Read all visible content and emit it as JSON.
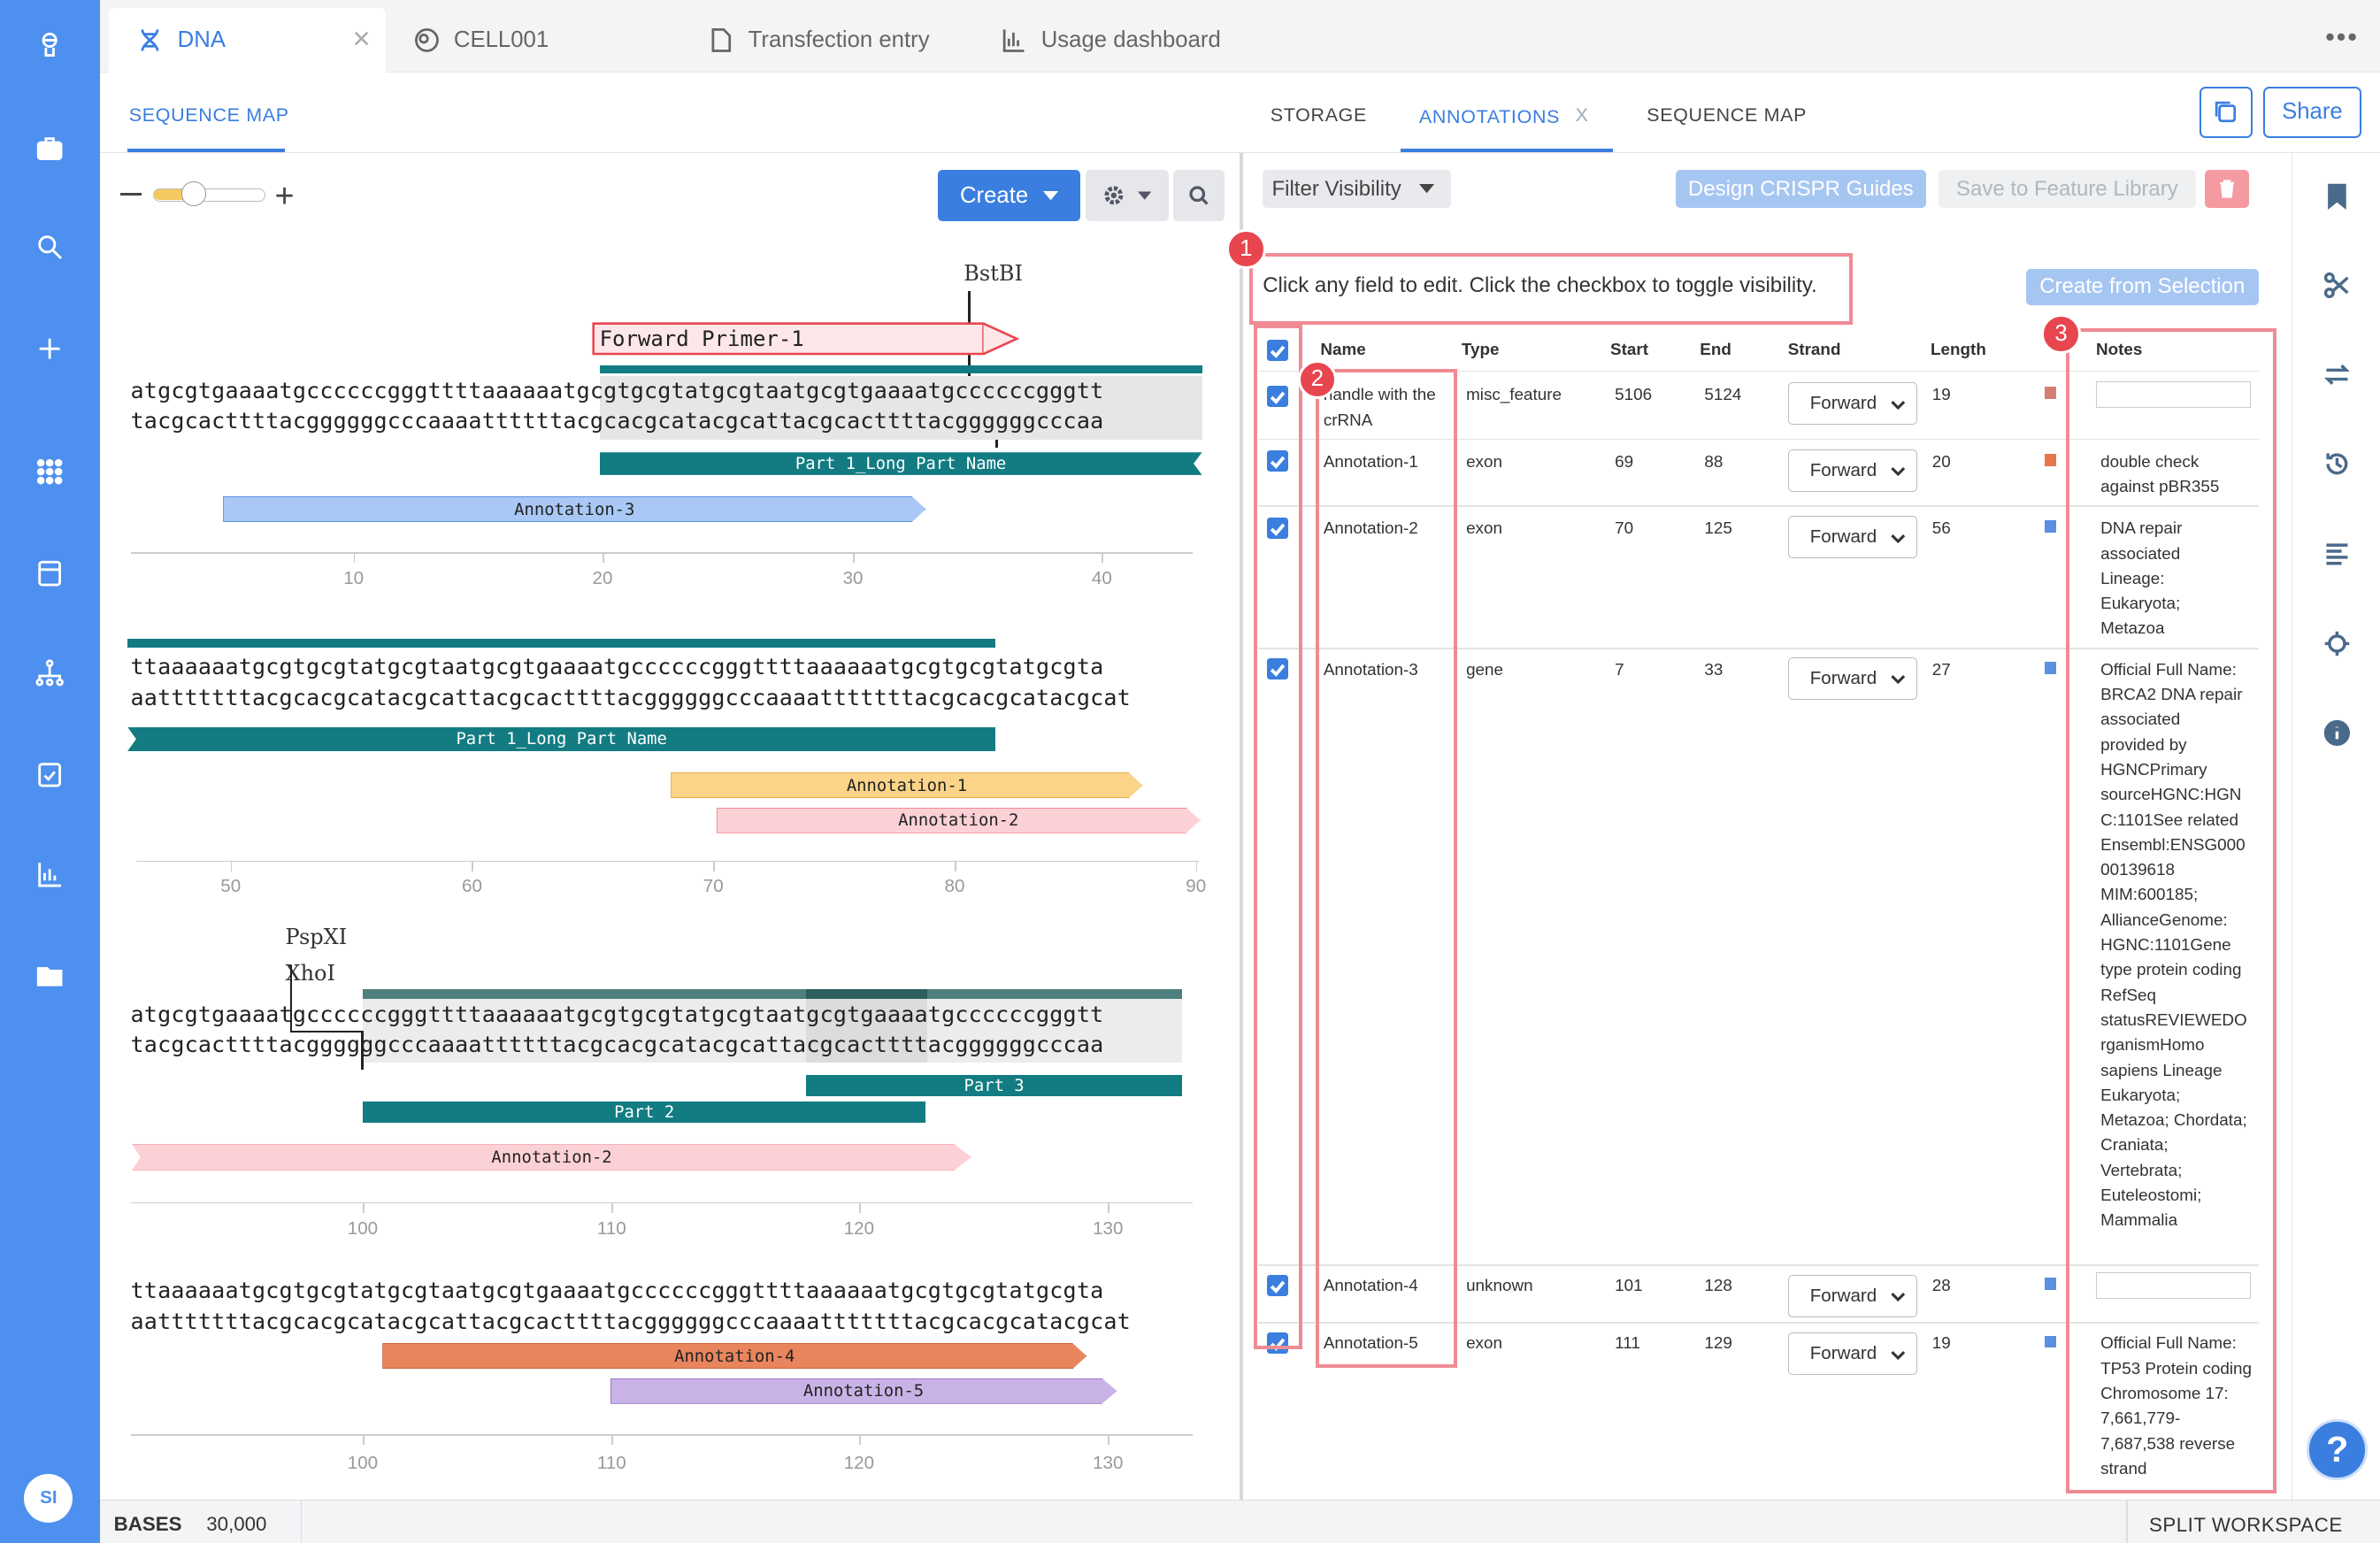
{
  "doc_tabs": [
    {
      "label": "DNA",
      "icon": "dna-icon",
      "active": true
    },
    {
      "label": "CELL001",
      "icon": "cell-icon"
    },
    {
      "label": "Transfection entry",
      "icon": "document-icon"
    },
    {
      "label": "Usage dashboard",
      "icon": "bar-chart-icon"
    }
  ],
  "doc_tab_close": "×",
  "more_menu": "•••",
  "left_subtab": "SEQUENCE MAP",
  "right_subtabs": [
    {
      "label": "STORAGE"
    },
    {
      "label": "ANNOTATIONS",
      "active": true,
      "close": "X"
    },
    {
      "label": "SEQUENCE MAP"
    }
  ],
  "share_label": "Share",
  "create_label": "Create",
  "filter_label": "Filter Visibility",
  "design_crispr_label": "Design CRISPR Guides",
  "save_feature_label": "Save to Feature Library",
  "create_selection_label": "Create from Selection",
  "help_text": "Click any field to edit. Click the checkbox to toggle visibility.",
  "table": {
    "headers": [
      "Name",
      "Type",
      "Start",
      "End",
      "Strand",
      "Length",
      "Notes"
    ],
    "rows": [
      {
        "name": "handle with the crRNA",
        "type": "misc_feature",
        "start": "5106",
        "end": "5124",
        "strand": "Forward",
        "length": "19",
        "color": "#d57f73",
        "notes": ""
      },
      {
        "name": "Annotation-1",
        "type": "exon",
        "start": "69",
        "end": "88",
        "strand": "Forward",
        "length": "20",
        "color": "#e9754a",
        "notes": "double check against pBR355"
      },
      {
        "name": "Annotation-2",
        "type": "exon",
        "start": "70",
        "end": "125",
        "strand": "Forward",
        "length": "56",
        "color": "#5b8fe0",
        "notes": "DNA repair associated Lineage: Eukaryota; Metazoa"
      },
      {
        "name": "Annotation-3",
        "type": "gene",
        "start": "7",
        "end": "33",
        "strand": "Forward",
        "length": "27",
        "color": "#5b8fe0",
        "notes": "Official Full Name: BRCA2 DNA repair associated provided by HGNCPrimary sourceHGNC:HGNC:1101See related Ensembl:ENSG00000139618 MIM:600185; AllianceGenome: HGNC:1101Gene type protein coding RefSeq statusREVIEWEDO rganismHomo sapiens Lineage Eukaryota; Metazoa; Chordata; Craniata; Vertebrata; Euteleostomi; Mammalia"
      },
      {
        "name": "Annotation-4",
        "type": "unknown",
        "start": "101",
        "end": "128",
        "strand": "Forward",
        "length": "28",
        "color": "#5b8fe0",
        "notes": ""
      },
      {
        "name": "Annotation-5",
        "type": "exon",
        "start": "111",
        "end": "129",
        "strand": "Forward",
        "length": "19",
        "color": "#5b8fe0",
        "notes": "Official Full Name: TP53 Protein coding Chromosome 17: 7,661,779-7,687,538 reverse strand"
      }
    ]
  },
  "badges": [
    "1",
    "2",
    "3"
  ],
  "sequence": {
    "rows": [
      {
        "top": "atgcgtgaaaatgccccccgggttttaaaaaatgcgtgcgtatgcgtaatgcgtgaaaatgccccccgggtt",
        "bottom": "tacgcacttttacggggggcccaaaattttttacgcacgcatacgcattacgcacttttacggggggcccaa",
        "ticks": [
          "10",
          "20",
          "30",
          "40"
        ]
      },
      {
        "top": "ttaaaaaatgcgtgcgtatgcgtaatgcgtgaaaatgccccccgggttttaaaaaatgcgtgcgtatgcgta",
        "bottom": "aatttttttacgcacgcatacgcattacgcacttttacggggggcccaaaatttttttacgcacgcatacgcat",
        "ticks": [
          "50",
          "60",
          "70",
          "80",
          "90"
        ]
      },
      {
        "top": "atgcgtgaaaatgccccccgggttttaaaaaatgcgtgcgtatgcgtaatgcgtgaaaatgccccccgggtt",
        "bottom": "tacgcacttttacggggggcccaaaattttttacgcacgcatacgcattacgcacttttacggggggcccaa",
        "ticks": [
          "100",
          "110",
          "120",
          "130"
        ]
      },
      {
        "top": "ttaaaaaatgcgtgcgtatgcgtaatgcgtgaaaatgccccccgggttttaaaaaatgcgtgcgtatgcgta",
        "bottom": "aatttttttacgcacgcatacgcattacgcacttttacggggggcccaaaatttttttacgcacgcatacgcat",
        "ticks": [
          "100",
          "110",
          "120",
          "130"
        ]
      }
    ],
    "features": {
      "forward_primer": "Forward Primer-1",
      "part1": "Part 1_Long Part Name",
      "part2": "Part 2",
      "part3": "Part 3",
      "ann1": "Annotation-1",
      "ann2": "Annotation-2",
      "ann3": "Annotation-3",
      "ann4": "Annotation-4",
      "ann5": "Annotation-5"
    },
    "cut_sites": {
      "bstbi": "BstBI",
      "pspxi": "PspXI",
      "xhoi": "XhoI"
    }
  },
  "footer": {
    "bases_label": "BASES",
    "bases_value": "30,000",
    "split_label": "SPLIT WORKSPACE"
  },
  "avatar": "SI",
  "help_button": "?",
  "colors": {
    "accent": "#3a7ee0",
    "nav": "#4d90ef",
    "part": "#127c82",
    "annotation_box": "#f08b94",
    "badge": "#e8464f"
  }
}
